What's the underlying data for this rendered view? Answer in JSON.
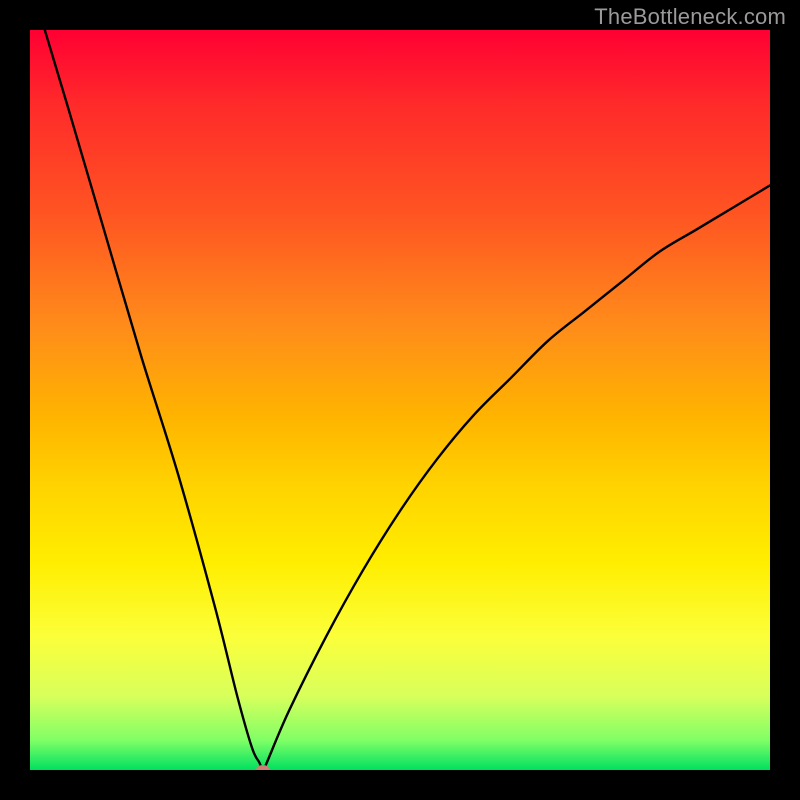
{
  "watermark": "TheBottleneck.com",
  "chart_data": {
    "type": "line",
    "title": "",
    "xlabel": "",
    "ylabel": "",
    "xlim": [
      0,
      100
    ],
    "ylim": [
      0,
      100
    ],
    "grid": false,
    "legend": false,
    "series": [
      {
        "name": "curve",
        "x": [
          2,
          5,
          10,
          15,
          20,
          25,
          28,
          30,
          31,
          31.5,
          32,
          35,
          40,
          45,
          50,
          55,
          60,
          65,
          70,
          75,
          80,
          85,
          90,
          95,
          100
        ],
        "y": [
          100,
          90,
          73,
          56,
          40,
          22,
          10,
          3,
          1,
          0,
          1,
          8,
          18,
          27,
          35,
          42,
          48,
          53,
          58,
          62,
          66,
          70,
          73,
          76,
          79
        ]
      }
    ],
    "marker": {
      "x": 31.5,
      "y": 0
    },
    "background_gradient": {
      "top": "#ff0033",
      "mid": "#ffd400",
      "bottom": "#00e060"
    }
  }
}
